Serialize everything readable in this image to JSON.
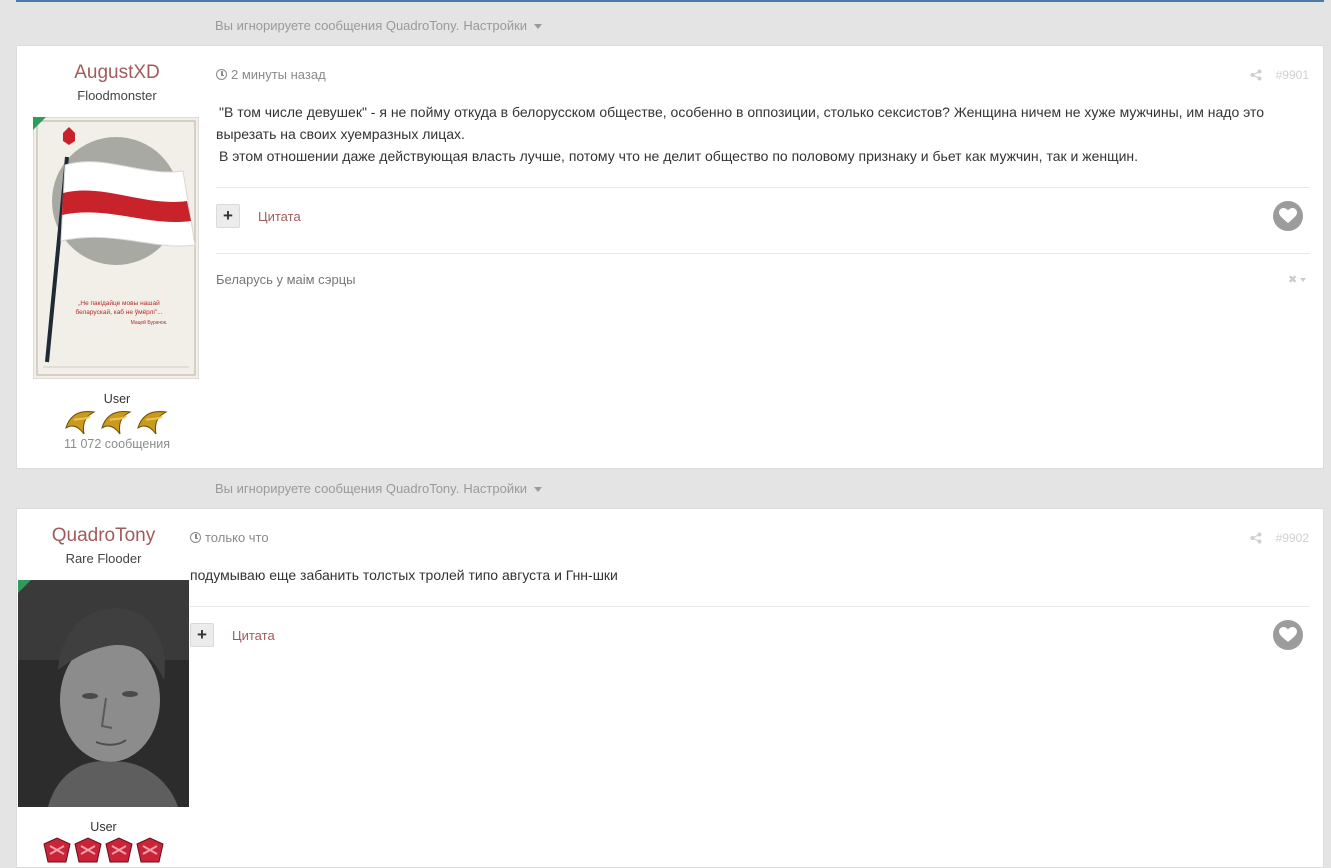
{
  "ignore_notice": {
    "text": "Вы игнорируете сообщения QuadroTony.",
    "settings_label": "Настройки"
  },
  "posts": [
    {
      "author": {
        "name": "AugustXD",
        "title": "Floodmonster",
        "group": "User",
        "posts_count": "11 072 сообщения"
      },
      "time": "2 минуты назад",
      "post_number": "#9901",
      "content_lines": [
        "\"В том числе девушек\" - я не пойму откуда в белорусском обществе, особенно в оппозиции, столько сексистов? Женщина ничем не хуже мужчины, им надо это",
        "вырезать на своих хуемразных лицах.",
        "В этом отношении даже действующая власть лучше, потому что не делит общество по половому признаку и бьет как мужчин, так и женщин."
      ],
      "quote_label": "Цитата",
      "plus_label": "+",
      "signature": "Беларусь у маім сэрцы",
      "avatar_caption": [
        "„Не пакідайце мовы нашай",
        "беларускай, каб не ўмёрлі\"...",
        "Мацей Бурачок."
      ]
    },
    {
      "author": {
        "name": "QuadroTony",
        "title": "Rare Flooder",
        "group": "User"
      },
      "time": "только что",
      "post_number": "#9902",
      "content_lines": [
        "подумываю еще забанить толстых тролей типо августа и Гнн-шки"
      ],
      "quote_label": "Цитата",
      "plus_label": "+"
    }
  ],
  "colors": {
    "author_name": "#a25b5b",
    "online": "#2e9a5b",
    "top_line": "#4a7aa6"
  }
}
